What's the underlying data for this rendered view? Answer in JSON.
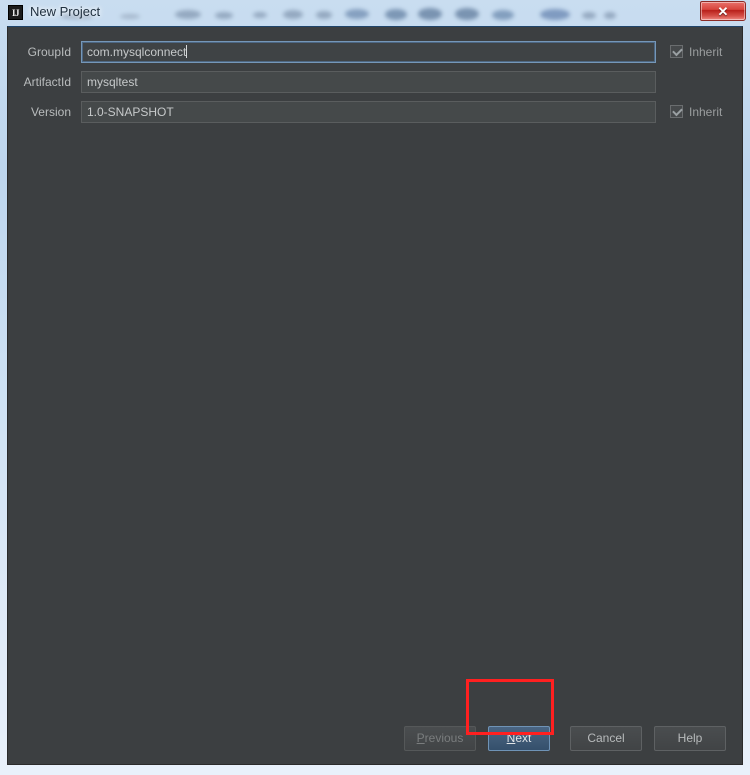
{
  "window": {
    "title": "New Project",
    "app_icon_text": "IJ",
    "close_icon": "close-icon",
    "close_glyph": "✕",
    "accent_focus_color": "#7597b8",
    "background_color": "#3c3f41",
    "annotation_color": "#ff2020"
  },
  "form": {
    "rows": [
      {
        "label": "GroupId",
        "value": "com.mysqlconnect",
        "focused": true,
        "has_inherit": true,
        "inherit_label": "Inherit",
        "inherit_checked": true,
        "inherit_disabled": true
      },
      {
        "label": "ArtifactId",
        "value": "mysqltest",
        "focused": false,
        "has_inherit": false,
        "inherit_label": "",
        "inherit_checked": false,
        "inherit_disabled": false
      },
      {
        "label": "Version",
        "value": "1.0-SNAPSHOT",
        "focused": false,
        "has_inherit": true,
        "inherit_label": "Inherit",
        "inherit_checked": true,
        "inherit_disabled": true
      }
    ]
  },
  "footer": {
    "buttons": [
      {
        "name": "previous",
        "label": "Previous",
        "mnemonic": "P",
        "state": "disabled"
      },
      {
        "name": "next",
        "label": "Next",
        "mnemonic": "N",
        "state": "default"
      },
      {
        "name": "cancel",
        "label": "Cancel",
        "mnemonic": "",
        "state": "normal"
      },
      {
        "name": "help",
        "label": "Help",
        "mnemonic": "",
        "state": "normal"
      }
    ]
  }
}
